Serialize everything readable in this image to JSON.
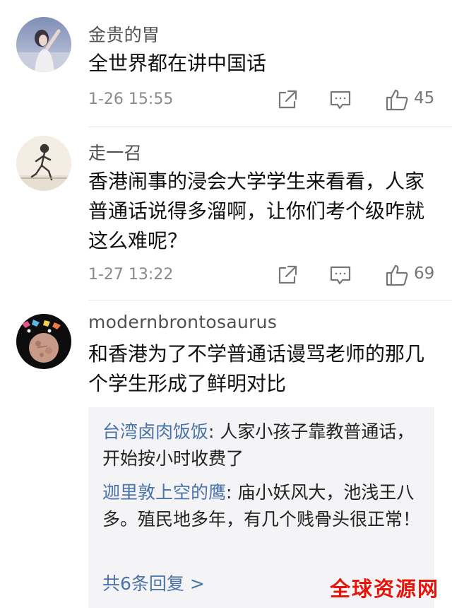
{
  "comments": [
    {
      "username": "金贵的胃",
      "body": "全世界都在讲中国话",
      "time": "1-26 15:55",
      "likes": "45"
    },
    {
      "username": "走一召",
      "body": "香港闹事的浸会大学学生来看看，人家普通话说得多溜啊，让你们考个级咋就这么难呢？",
      "time": "1-27 13:22",
      "likes": "69"
    },
    {
      "username": "modernbrontosaurus",
      "body": "和香港为了不学普通话谩骂老师的那几个学生形成了鲜明对比",
      "replies": [
        {
          "author": "台湾卤肉饭饭",
          "text": "人家小孩子靠教普通话，开始按小时收费了"
        },
        {
          "author": "迦里敦上空的鹰",
          "text": "庙小妖风大，池浅王八多。殖民地多年，有几个贱骨头很正常！"
        }
      ],
      "more_replies": "共6条回复 >"
    }
  ],
  "reply_separator": ": ",
  "watermark": "全球资源网",
  "icons": {
    "share": "share-icon",
    "reply": "comment-icon",
    "like": "thumbs-up-icon"
  },
  "colors": {
    "link": "#4a73a8",
    "watermark": "#e8140c",
    "reply_background": "#f4f4f6"
  }
}
